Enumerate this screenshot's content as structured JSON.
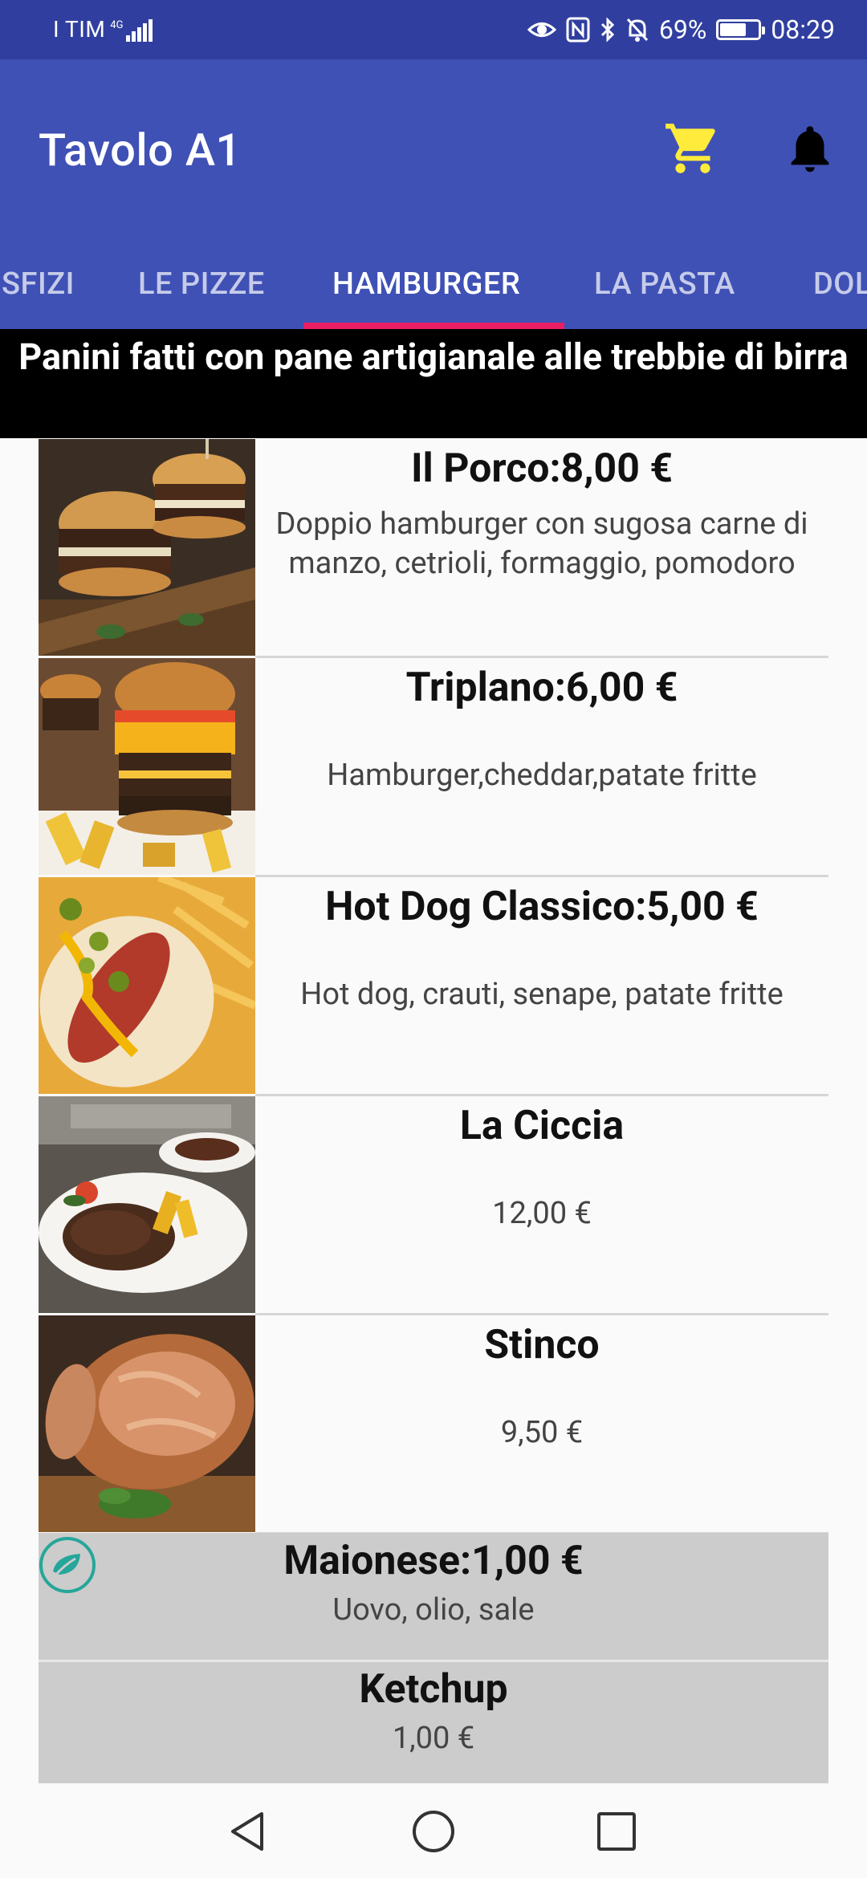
{
  "status_bar": {
    "carrier": "I TIM",
    "network": "4G",
    "battery_percent": "69%",
    "battery_level": 0.69,
    "time": "08:29",
    "icons": [
      "eye-icon",
      "nfc-icon",
      "bluetooth-icon",
      "silent-bell-icon",
      "battery-icon"
    ]
  },
  "app_bar": {
    "title": "Tavolo A1",
    "cart_icon_color": "#ffeb3b",
    "bell_icon_color": "#000000"
  },
  "tabs": [
    {
      "label": "SFIZI"
    },
    {
      "label": "LE PIZZE"
    },
    {
      "label": "HAMBURGER",
      "active": true
    },
    {
      "label": "LA PASTA"
    },
    {
      "label": "DOL"
    }
  ],
  "colors": {
    "status_bar": "#303f9f",
    "primary": "#3f51b5",
    "tab_indicator": "#e91e63",
    "extras_bg": "#cccccc",
    "leaf_badge": "#26a69a"
  },
  "section": {
    "banner": "Panini fatti con pane artigianale alle trebbie di birra"
  },
  "products": [
    {
      "name": "Il Porco:8,00 €",
      "description": "Doppio hamburger con sugosa carne di manzo, cetrioli, formaggio, pomodoro",
      "image_icon": "burger-photo"
    },
    {
      "name": "Triplano:6,00 €",
      "description": "Hamburger,cheddar,patate fritte",
      "image_icon": "triple-burger-photo"
    },
    {
      "name": "Hot Dog Classico:5,00 €",
      "description": "Hot dog, crauti, senape, patate fritte",
      "image_icon": "hotdog-photo"
    },
    {
      "name": "La Ciccia",
      "description": "12,00 €",
      "image_icon": "steak-photo"
    },
    {
      "name": "Stinco",
      "description": "9,50 €",
      "image_icon": "pork-shank-photo"
    }
  ],
  "extras": [
    {
      "name": "Maionese:1,00 €",
      "description": "Uovo, olio, sale",
      "badge_icon": "leaf-icon"
    },
    {
      "name": "Ketchup",
      "description": "1,00 €"
    }
  ],
  "nav_bar": {
    "icons": [
      "back-icon",
      "home-icon",
      "recents-icon"
    ]
  }
}
